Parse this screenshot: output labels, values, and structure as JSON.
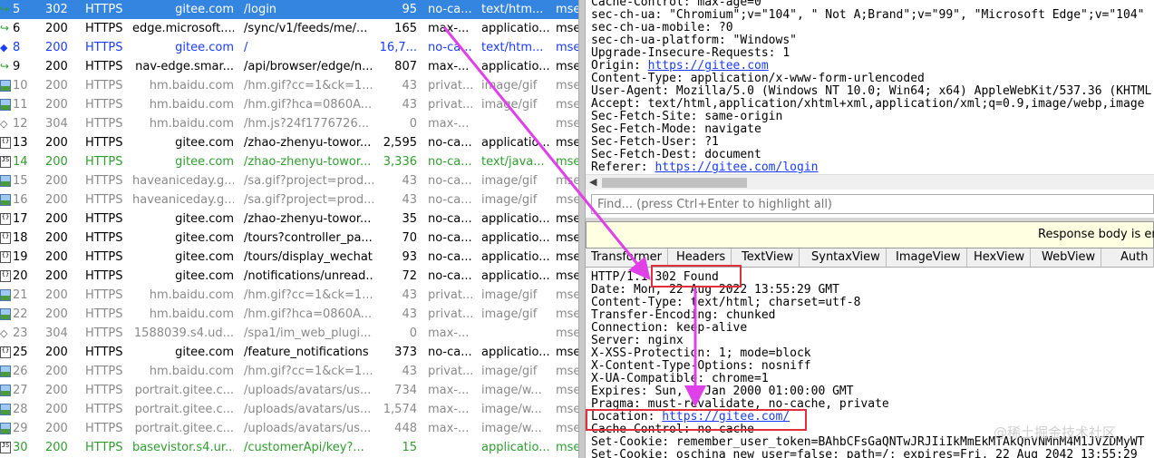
{
  "sessions": [
    {
      "num": "5",
      "result": "302",
      "protocol": "HTTPS",
      "host": "gitee.com",
      "url": "/login",
      "body": "95",
      "caching": "no-ca...",
      "ctype": "text/htm...",
      "process": "mse",
      "style": "selected",
      "icon": "redirect-icon"
    },
    {
      "num": "6",
      "result": "200",
      "protocol": "HTTPS",
      "host": "edge.microsoft....",
      "url": "/sync/v1/feeds/me/...",
      "body": "165",
      "caching": "max-...",
      "ctype": "applicatio...",
      "process": "mse",
      "style": "normal",
      "icon": "redirect-icon"
    },
    {
      "num": "8",
      "result": "200",
      "protocol": "HTTPS",
      "host": "gitee.com",
      "url": "/",
      "body": "16,7...",
      "caching": "no-ca...",
      "ctype": "text/htm...",
      "process": "mse",
      "style": "blue",
      "icon": "html-icon"
    },
    {
      "num": "9",
      "result": "200",
      "protocol": "HTTPS",
      "host": "nav-edge.smar...",
      "url": "/api/browser/edge/n...",
      "body": "807",
      "caching": "max-...",
      "ctype": "applicatio...",
      "process": "mse",
      "style": "normal",
      "icon": "redirect-icon"
    },
    {
      "num": "10",
      "result": "200",
      "protocol": "HTTPS",
      "host": "hm.baidu.com",
      "url": "/hm.gif?cc=1&ck=1...",
      "body": "43",
      "caching": "privat...",
      "ctype": "image/gif",
      "process": "mse",
      "style": "gray",
      "icon": "image-icon"
    },
    {
      "num": "11",
      "result": "200",
      "protocol": "HTTPS",
      "host": "hm.baidu.com",
      "url": "/hm.gif?hca=0860A...",
      "body": "43",
      "caching": "privat...",
      "ctype": "image/gif",
      "process": "mse",
      "style": "gray",
      "icon": "image-icon"
    },
    {
      "num": "12",
      "result": "304",
      "protocol": "HTTPS",
      "host": "hm.baidu.com",
      "url": "/hm.js?24f1776726...",
      "body": "0",
      "caching": "max-...",
      "ctype": "",
      "process": "mse",
      "style": "gray",
      "icon": "not-modified-icon"
    },
    {
      "num": "13",
      "result": "200",
      "protocol": "HTTPS",
      "host": "gitee.com",
      "url": "/zhao-zhenyu-towor...",
      "body": "2,595",
      "caching": "no-ca...",
      "ctype": "applicatio...",
      "process": "mse",
      "style": "normal",
      "icon": "json-icon"
    },
    {
      "num": "14",
      "result": "200",
      "protocol": "HTTPS",
      "host": "gitee.com",
      "url": "/zhao-zhenyu-towor...",
      "body": "3,336",
      "caching": "no-ca...",
      "ctype": "text/java...",
      "process": "mse",
      "style": "green",
      "icon": "script-icon"
    },
    {
      "num": "15",
      "result": "200",
      "protocol": "HTTPS",
      "host": "haveaniceday.g...",
      "url": "/sa.gif?project=prod...",
      "body": "43",
      "caching": "no-ca...",
      "ctype": "image/gif",
      "process": "mse",
      "style": "gray",
      "icon": "image-icon"
    },
    {
      "num": "16",
      "result": "200",
      "protocol": "HTTPS",
      "host": "haveaniceday.g...",
      "url": "/sa.gif?project=prod...",
      "body": "43",
      "caching": "no-ca...",
      "ctype": "image/gif",
      "process": "mse",
      "style": "gray",
      "icon": "image-icon"
    },
    {
      "num": "17",
      "result": "200",
      "protocol": "HTTPS",
      "host": "gitee.com",
      "url": "/zhao-zhenyu-towor...",
      "body": "35",
      "caching": "no-ca...",
      "ctype": "applicatio...",
      "process": "mse",
      "style": "normal",
      "icon": "json-icon"
    },
    {
      "num": "18",
      "result": "200",
      "protocol": "HTTPS",
      "host": "gitee.com",
      "url": "/tours?controller_pa...",
      "body": "70",
      "caching": "no-ca...",
      "ctype": "applicatio...",
      "process": "mse",
      "style": "normal",
      "icon": "json-icon"
    },
    {
      "num": "19",
      "result": "200",
      "protocol": "HTTPS",
      "host": "gitee.com",
      "url": "/tours/display_wechat",
      "body": "93",
      "caching": "no-ca...",
      "ctype": "applicatio...",
      "process": "mse",
      "style": "normal",
      "icon": "json-icon"
    },
    {
      "num": "20",
      "result": "200",
      "protocol": "HTTPS",
      "host": "gitee.com",
      "url": "/notifications/unread...",
      "body": "72",
      "caching": "no-ca...",
      "ctype": "applicatio...",
      "process": "mse",
      "style": "normal",
      "icon": "json-icon"
    },
    {
      "num": "21",
      "result": "200",
      "protocol": "HTTPS",
      "host": "hm.baidu.com",
      "url": "/hm.gif?cc=1&ck=1...",
      "body": "43",
      "caching": "privat...",
      "ctype": "image/gif",
      "process": "mse",
      "style": "gray",
      "icon": "image-icon"
    },
    {
      "num": "22",
      "result": "200",
      "protocol": "HTTPS",
      "host": "hm.baidu.com",
      "url": "/hm.gif?hca=0860A...",
      "body": "43",
      "caching": "privat...",
      "ctype": "image/gif",
      "process": "mse",
      "style": "gray",
      "icon": "image-icon"
    },
    {
      "num": "23",
      "result": "304",
      "protocol": "HTTPS",
      "host": "1588039.s4.ud...",
      "url": "/spa1/im_web_plugi...",
      "body": "0",
      "caching": "max-...",
      "ctype": "",
      "process": "mse",
      "style": "gray",
      "icon": "not-modified-icon"
    },
    {
      "num": "25",
      "result": "200",
      "protocol": "HTTPS",
      "host": "gitee.com",
      "url": "/feature_notifications",
      "body": "373",
      "caching": "no-ca...",
      "ctype": "applicatio...",
      "process": "mse",
      "style": "normal",
      "icon": "json-icon"
    },
    {
      "num": "26",
      "result": "200",
      "protocol": "HTTPS",
      "host": "hm.baidu.com",
      "url": "/hm.gif?cc=1&ck=1...",
      "body": "43",
      "caching": "privat...",
      "ctype": "image/gif",
      "process": "mse",
      "style": "gray",
      "icon": "image-icon"
    },
    {
      "num": "27",
      "result": "200",
      "protocol": "HTTPS",
      "host": "portrait.gitee.c...",
      "url": "/uploads/avatars/us...",
      "body": "734",
      "caching": "max-...",
      "ctype": "image/w...",
      "process": "mse",
      "style": "gray",
      "icon": "image-icon"
    },
    {
      "num": "28",
      "result": "200",
      "protocol": "HTTPS",
      "host": "portrait.gitee.c...",
      "url": "/uploads/avatars/us...",
      "body": "1,574",
      "caching": "max-...",
      "ctype": "image/w...",
      "process": "mse",
      "style": "gray",
      "icon": "image-icon"
    },
    {
      "num": "29",
      "result": "200",
      "protocol": "HTTPS",
      "host": "portrait.gitee.c...",
      "url": "/uploads/avatars/us...",
      "body": "448",
      "caching": "max-...",
      "ctype": "image/w...",
      "process": "mse",
      "style": "gray",
      "icon": "image-icon"
    },
    {
      "num": "30",
      "result": "200",
      "protocol": "HTTPS",
      "host": "basevistor.s4.ur...",
      "url": "/customerApi/key?...",
      "body": "15",
      "caching": "",
      "ctype": "applicatio...",
      "process": "mse",
      "style": "green",
      "icon": "script-icon"
    }
  ],
  "request_headers": [
    "Cache-Control: max-age=0",
    "sec-ch-ua: \"Chromium\";v=\"104\", \" Not A;Brand\";v=\"99\", \"Microsoft Edge\";v=\"104\"",
    "sec-ch-ua-mobile: ?0",
    "sec-ch-ua-platform: \"Windows\"",
    "Upgrade-Insecure-Requests: 1",
    "Content-Type: application/x-www-form-urlencoded",
    "User-Agent: Mozilla/5.0 (Windows NT 10.0; Win64; x64) AppleWebKit/537.36 (KHTML",
    "Accept: text/html,application/xhtml+xml,application/xml;q=0.9,image/webp,image",
    "Sec-Fetch-Site: same-origin",
    "Sec-Fetch-Mode: navigate",
    "Sec-Fetch-User: ?1",
    "Sec-Fetch-Dest: document"
  ],
  "origin_label": "Origin: ",
  "origin_url": "https://gitee.com",
  "referer_label": "Referer: ",
  "referer_url": "https://gitee.com/login",
  "find_placeholder": "Find... (press Ctrl+Enter to highlight all)",
  "notice_text": "Response body is enc",
  "tabs": [
    "Transformer",
    "Headers",
    "TextView",
    "SyntaxView",
    "ImageView",
    "HexView",
    "WebView",
    "Auth"
  ],
  "response": {
    "status_prefix": "HTTP/1.1 ",
    "status_text": "302 Found",
    "lines_before_location": [
      "Date: Mon, 22 Aug 2022 13:55:29 GMT",
      "Content-Type: text/html; charset=utf-8",
      "Transfer-Encoding: chunked",
      "Connection: keep-alive",
      "Server: nginx",
      "X-XSS-Protection: 1; mode=block",
      "X-Content-Type-Options: nosniff",
      "X-UA-Compatible: chrome=1",
      "Expires: Sun, 1 Jan 2000 01:00:00 GMT",
      "Pragma: must-revalidate, no-cache, private"
    ],
    "location_label": "Location: ",
    "location_url": "https://gitee.com/",
    "lines_after_location": [
      "Cache-Control: no-cache",
      "Set-Cookie: remember_user_token=BAhbCFsGaQNTwJRJIiIkMmEkMTAkQnVNMnM4M1JVZDMyWT",
      "Set-Cookie: oschina_new_user=false; path=/; expires=Fri, 22 Aug 2042 13:55:29"
    ]
  },
  "watermark": "@稀土掘金技术社区",
  "colors": {
    "selected": "#3385e0",
    "annotation": "#e0303a",
    "arrow": "#e040e8",
    "link": "#1a3cff"
  }
}
